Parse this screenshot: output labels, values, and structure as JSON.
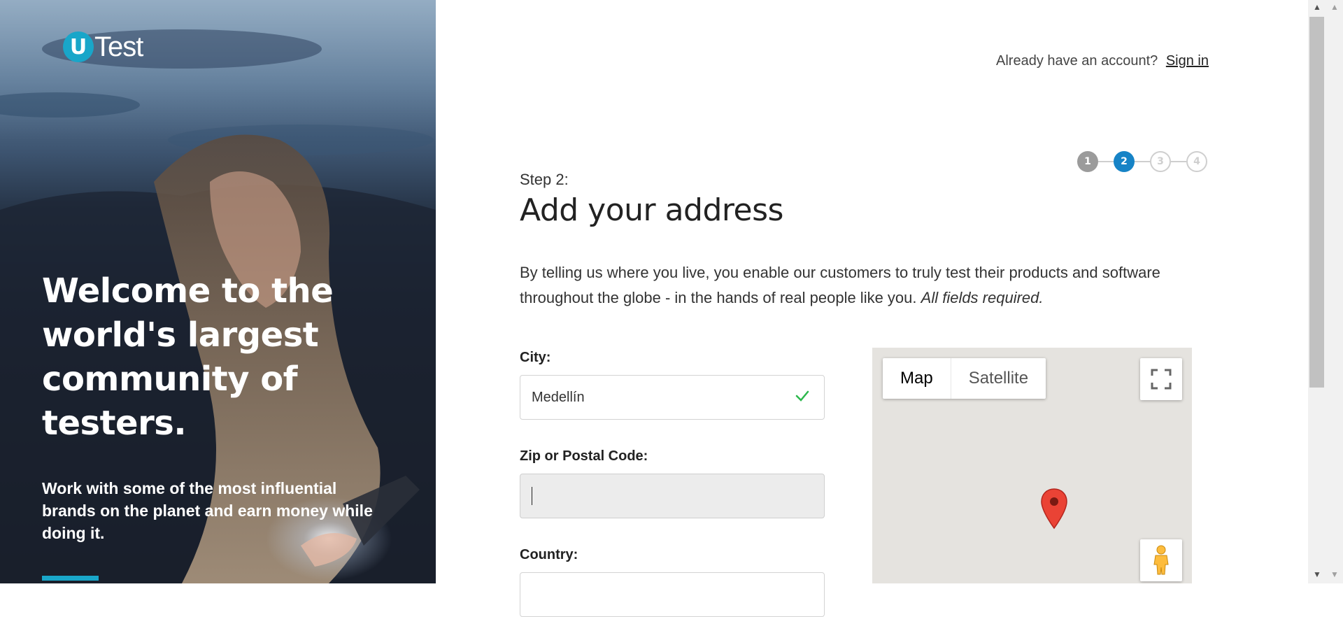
{
  "brand": {
    "logo_letter": "U",
    "logo_word": "Test",
    "accent": "#19a6c9"
  },
  "hero": {
    "headline": "Welcome to the world's largest community of testers.",
    "subtext": "Work with some of the most influential brands on the planet and earn money while doing it."
  },
  "header": {
    "prompt": "Already have an account?",
    "signin_label": "Sign in"
  },
  "steps": {
    "items": [
      "1",
      "2",
      "3",
      "4"
    ],
    "current": 2,
    "active_color": "#1683c6"
  },
  "form": {
    "step_label": "Step 2:",
    "title": "Add your address",
    "intro": "By telling us where you live, you enable our customers to truly test their products and software throughout the globe - in the hands of real people like you.",
    "intro_emphasis": "All fields required.",
    "city_label": "City:",
    "city_value": "Medellín",
    "zip_label": "Zip or Postal Code:",
    "zip_value": "",
    "country_label": "Country:"
  },
  "map": {
    "map_label": "Map",
    "satellite_label": "Satellite",
    "selected": "Map"
  }
}
